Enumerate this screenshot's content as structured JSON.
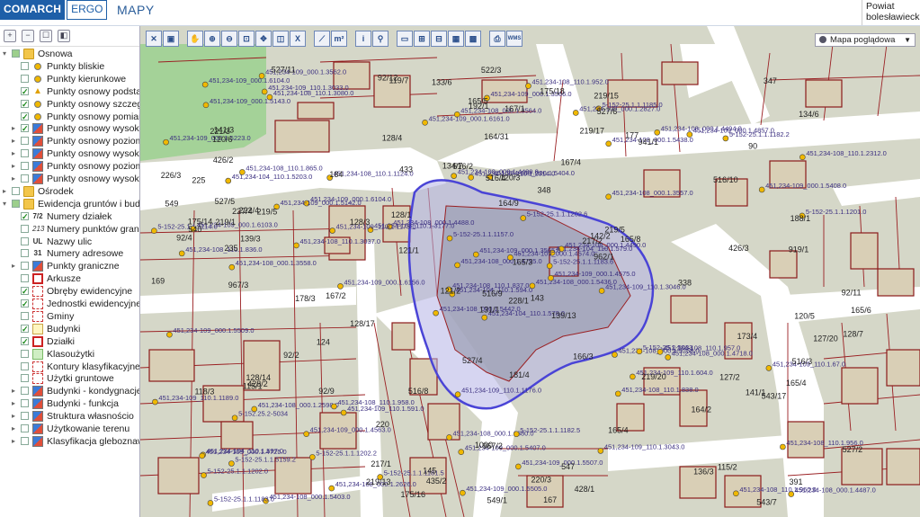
{
  "header": {
    "brand_main": "COMARCH",
    "brand_sub": "ERGO",
    "app_title": "MAPY",
    "region_line1": "Powiat",
    "region_line2": "bolesławiecki"
  },
  "map_type": {
    "label": "Mapa poglądowa"
  },
  "colors": {
    "parcel_border": "#9a1f22",
    "building_border": "#8b1a1a",
    "road_fill": "#ffffff",
    "block_fill": "#d5d7c8",
    "green_fill": "#a4d298",
    "selection_stroke": "#4a44d6",
    "selection_fill": "#b5b3e6",
    "point_fill": "#f0b800",
    "label_color": "#3b2f80"
  },
  "tree": [
    {
      "indent": 0,
      "twisty": "▾",
      "check": "partial",
      "icon": "folder-icon",
      "label": "Osnowa"
    },
    {
      "indent": 1,
      "twisty": "",
      "check": "off",
      "icon": "point-dot-icon",
      "label": "Punkty bliskie"
    },
    {
      "indent": 1,
      "twisty": "",
      "check": "off",
      "icon": "point-dot-icon",
      "label": "Punkty kierunkowe"
    },
    {
      "indent": 1,
      "twisty": "",
      "check": "on",
      "icon": "triangle-icon",
      "label": "Punkty osnowy podsta"
    },
    {
      "indent": 1,
      "twisty": "",
      "check": "on",
      "icon": "point-dot-icon",
      "label": "Punkty osnowy szczeg"
    },
    {
      "indent": 1,
      "twisty": "",
      "check": "on",
      "icon": "point-dot-icon",
      "label": "Punkty osnowy pomiar"
    },
    {
      "indent": 1,
      "twisty": "▸",
      "check": "on",
      "icon": "multi-style-icon",
      "label": "Punkty osnowy wysoko"
    },
    {
      "indent": 1,
      "twisty": "▸",
      "check": "off",
      "icon": "multi-style-icon",
      "label": "Punkty osnowy poziom"
    },
    {
      "indent": 1,
      "twisty": "▸",
      "check": "off",
      "icon": "multi-style-icon",
      "label": "Punkty osnowy wysoko"
    },
    {
      "indent": 1,
      "twisty": "▸",
      "check": "off",
      "icon": "multi-style-icon",
      "label": "Punkty osnowy poziom"
    },
    {
      "indent": 1,
      "twisty": "▸",
      "check": "off",
      "icon": "multi-style-icon",
      "label": "Punkty osnowy wysoko"
    },
    {
      "indent": 0,
      "twisty": "▸",
      "check": "off",
      "icon": "folder-icon",
      "label": "Ośrodek"
    },
    {
      "indent": 0,
      "twisty": "▾",
      "check": "partial",
      "icon": "folder-icon",
      "label": "Ewidencja gruntów i budy"
    },
    {
      "indent": 1,
      "twisty": "",
      "check": "on",
      "icon": "text-7-2-icon",
      "label": "Numery działek"
    },
    {
      "indent": 1,
      "twisty": "",
      "check": "off",
      "icon": "text-213-icon",
      "label": "Numery punktów grani"
    },
    {
      "indent": 1,
      "twisty": "",
      "check": "off",
      "icon": "text-ul-icon",
      "label": "Nazwy ulic"
    },
    {
      "indent": 1,
      "twisty": "",
      "check": "off",
      "icon": "text-31-icon",
      "label": "Numery adresowe"
    },
    {
      "indent": 1,
      "twisty": "▸",
      "check": "off",
      "icon": "multi-style-icon",
      "label": "Punkty graniczne"
    },
    {
      "indent": 1,
      "twisty": "",
      "check": "off",
      "icon": "red-square-icon",
      "label": "Arkusze"
    },
    {
      "indent": 1,
      "twisty": "",
      "check": "on",
      "icon": "dashed-square-icon",
      "label": "Obręby ewidencyjne"
    },
    {
      "indent": 1,
      "twisty": "",
      "check": "on",
      "icon": "dashed-square-icon",
      "label": "Jednostki ewidencyjne"
    },
    {
      "indent": 1,
      "twisty": "",
      "check": "off",
      "icon": "dashed-square-icon",
      "label": "Gminy"
    },
    {
      "indent": 1,
      "twisty": "",
      "check": "on",
      "icon": "yellow-square-icon",
      "label": "Budynki"
    },
    {
      "indent": 1,
      "twisty": "",
      "check": "on",
      "icon": "red-square-icon",
      "label": "Działki"
    },
    {
      "indent": 1,
      "twisty": "",
      "check": "off",
      "icon": "green-square-icon",
      "label": "Klasoużytki"
    },
    {
      "indent": 1,
      "twisty": "",
      "check": "off",
      "icon": "dashed-square-icon",
      "label": "Kontury klasyfikacyjne"
    },
    {
      "indent": 1,
      "twisty": "",
      "check": "off",
      "icon": "dashed-square-icon",
      "label": "Użytki gruntowe"
    },
    {
      "indent": 1,
      "twisty": "▸",
      "check": "off",
      "icon": "multi-style-icon",
      "label": "Budynki - kondygnacje"
    },
    {
      "indent": 1,
      "twisty": "▸",
      "check": "off",
      "icon": "multi-style-icon",
      "label": "Budynki - funkcja"
    },
    {
      "indent": 1,
      "twisty": "▸",
      "check": "off",
      "icon": "multi-style-icon",
      "label": "Struktura własnościo"
    },
    {
      "indent": 1,
      "twisty": "▸",
      "check": "off",
      "icon": "multi-style-icon",
      "label": "Użytkowanie terenu"
    },
    {
      "indent": 1,
      "twisty": "▸",
      "check": "off",
      "icon": "multi-style-icon",
      "label": "Klasyfikacja gleboznaw"
    }
  ],
  "toolbar": [
    {
      "name": "close-map-icon",
      "glyph": "✕"
    },
    {
      "name": "save-map-icon",
      "glyph": "▣"
    },
    {
      "name": "sep",
      "glyph": ""
    },
    {
      "name": "pan-hand-icon",
      "glyph": "✋"
    },
    {
      "name": "zoom-in-icon",
      "glyph": "⊕"
    },
    {
      "name": "zoom-out-icon",
      "glyph": "⊖"
    },
    {
      "name": "zoom-window-icon",
      "glyph": "⊡"
    },
    {
      "name": "full-extent-icon",
      "glyph": "✥"
    },
    {
      "name": "previous-extent-icon",
      "glyph": "◫"
    },
    {
      "name": "clear-selection-icon",
      "glyph": "X"
    },
    {
      "name": "sep",
      "glyph": ""
    },
    {
      "name": "measure-distance-icon",
      "glyph": "⟋"
    },
    {
      "name": "measure-area-icon",
      "glyph": "m²"
    },
    {
      "name": "sep",
      "glyph": ""
    },
    {
      "name": "info-icon",
      "glyph": "i"
    },
    {
      "name": "locate-pin-icon",
      "glyph": "⚲"
    },
    {
      "name": "sep",
      "glyph": ""
    },
    {
      "name": "select-rectangle-icon",
      "glyph": "▭"
    },
    {
      "name": "select-add-icon",
      "glyph": "⊞"
    },
    {
      "name": "select-remove-icon",
      "glyph": "⊟"
    },
    {
      "name": "select-polygon-icon",
      "glyph": "▦"
    },
    {
      "name": "select-layer-icon",
      "glyph": "▩"
    },
    {
      "name": "sep",
      "glyph": ""
    },
    {
      "name": "print-icon",
      "glyph": "⎙"
    },
    {
      "name": "wms-icon",
      "glyph": "WMS"
    }
  ],
  "map_labels": {
    "parcels": [
      "919/1",
      "181/4",
      "115/2",
      "167",
      "165/4",
      "165/5",
      "165/6",
      "165/8",
      "164/2",
      "165/3",
      "165/4",
      "540",
      "549/1",
      "177",
      "941/1",
      "178/3",
      "92/12",
      "92/11",
      "92/4",
      "92/2",
      "92/9",
      "217/1",
      "217/2",
      "90",
      "121/1",
      "120/5",
      "120/6",
      "120/3",
      "121/2",
      "119/7",
      "118/3",
      "131/1",
      "134/6",
      "134/7",
      "133/6",
      "115/1",
      "347",
      "348",
      "433",
      "338",
      "124",
      "391",
      "435/2",
      "426/3",
      "426/2",
      "428/2",
      "428/1",
      "128/3",
      "128/4",
      "127/20",
      "127/2",
      "128/17",
      "128/14",
      "128/7",
      "128/1",
      "139/13",
      "139/3",
      "141/1",
      "143",
      "142/2",
      "141/3",
      "145",
      "136/3",
      "1000",
      "192/1",
      "188/1",
      "184",
      "175/14",
      "175/16",
      "173/4",
      "175/18",
      "164/31",
      "164/9",
      "167/2",
      "167/4",
      "166/3",
      "167/1",
      "169",
      "522/3",
      "527/6",
      "527/5",
      "527/4",
      "527/2",
      "527/11",
      "543/7",
      "543/17",
      "547",
      "549",
      "219/15",
      "219/5",
      "219/13",
      "219/17",
      "219/20",
      "226/3",
      "222/4",
      "225",
      "228/1",
      "220/3",
      "219/1",
      "221/3",
      "219/5",
      "227/4",
      "235",
      "220",
      "516/9",
      "516/3",
      "516/8",
      "516/4",
      "516/10",
      "962/1",
      "967/2",
      "967/3",
      "516/2"
    ],
    "points": [
      "451,234-104_110.1.578.0",
      "451,234-104_110.1.5203.0",
      "451,234-104_110.1.594.0",
      "451,234-104_110.1.597.0",
      "451,234-104_110.1.579.0",
      "451,234-109_110.1.591.0",
      "5-152-25.1.1.1185.0",
      "451,234-108_000.1.5404.0",
      "451,234-108_000.1.5438.0",
      "451,234-108_000.1.5436.0",
      "451,234-108_110.1.3080.0",
      "451,234-108_000.1.4487.0",
      "451,234-108_000.1.3558.0",
      "451,234-108_110.1.2312.0",
      "451,234-108_000.1.5442.0",
      "451,234-108_000.1.3557.0",
      "451,234-108_000.1.5403.0",
      "451,234-108_000.1.4489.0",
      "5-152-25.1.1.1202.6",
      "451,234-108_000.1.2598.0",
      "451,234-108_000.1.4488.0",
      "5-152-25.1.1.1202.0",
      "5-152-25.1.1.1202.2",
      "451,234-108_110.1.2314.0",
      "451,234-108_000.1.4490.0",
      "451,234-108_000.1.4718.0",
      "451,234-108_110.1.865.0",
      "451,234-108_000.1.3564.0",
      "451,234-108_110.1.836.0",
      "451,234-108_000.1.5258.0",
      "5-152-25.1.1.1201.0",
      "451,234-108_110.1.837.0",
      "451,234-108_000.1.1380.0",
      "451,234-108_000.1.4755.0",
      "451,234-108_110.1.1124.0",
      "451,234-108_000.1.4494.0",
      "451,234-108_110.1.958.0",
      "451,234-108_110.1.960.0",
      "451,234-108_110.1.956.0",
      "451,234-108_110.1.957.0",
      "451,234-108_110.1.952.0",
      "451,234-108_110.1.3177.0",
      "451,234-108_110.1.3037.0",
      "451,234-108_110.1.838.0",
      "451,234-108_000.1.2626.0",
      "5-152-25.1.1.1114.0",
      "5-152-25.1.1.1183.6",
      "5-152-25.1.1.1183.0",
      "451,234-109_000.1.5407.0",
      "451,234-109_000.1.4575.0",
      "5-152.25.2-5034",
      "451,234-109_000.1.5408.0",
      "451,234-109_000.1.5223.0",
      "451,234-109_110.1.604.0",
      "451,234-109_110.1.3043.0",
      "451,234-109_000.1.4563.0",
      "451,234-109_110.1.3033.0",
      "451,234-109_000.1.6104.0",
      "5-152-25.1.1.1182.5",
      "5-152-25.1.1.1182.2",
      "451,234-109_000.1.3566.0",
      "451,234-109_000.1.6156.0",
      "451,234-109_000.1.6103.0",
      "451,234-109_000.1.6104.0",
      "451,234-109_000.1.4857.0",
      "451,234-109_000.1.3562.0",
      "451,234-109_000.1.2827.0",
      "451,234-109_000.1.6161.0",
      "451,234-109_000.1.3565.0",
      "451,234-109_110.1.1189.0",
      "451,234-109_110.1.1176.0",
      "5-152-25.1.1.1181.5",
      "5-152-25.2-5033",
      "451,234-109_110.1.1175.0",
      "451,234-109_000.1.4725.0",
      "451,234-109_000.1.5143.0",
      "451,234-109_000.1.5142.0",
      "451,234-109_000.1.5509.0",
      "5-152-25.1.1.1157.0",
      "451,234-109_000.1.5507.0",
      "451,234-109_000.1.4574.0",
      "5-152-25.1.1.5159.2",
      "451,234-109_110.1.3046.0",
      "451,234-109_110.1.67.0",
      "451,234-109_000.1.5505.0"
    ]
  }
}
